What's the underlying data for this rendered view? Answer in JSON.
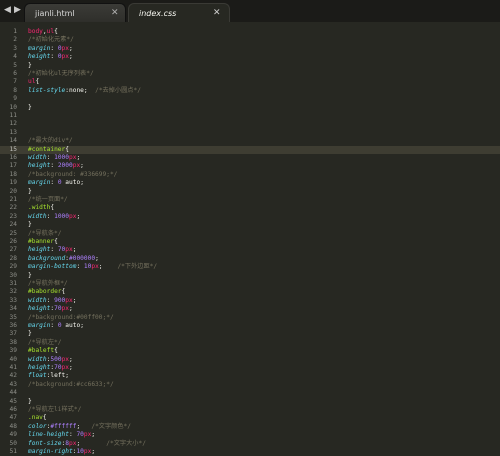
{
  "tabs": [
    {
      "label": "jianli.html",
      "active": false
    },
    {
      "label": "index.css",
      "active": true
    }
  ],
  "nav": {
    "back_icon": "arrow-left",
    "forward_icon": "arrow-right"
  },
  "editor": {
    "active_line": 15,
    "theme_colors": {
      "background": "#272822",
      "selector": "#f92672",
      "property": "#66d9ef",
      "number": "#ae81ff",
      "comment": "#75715e",
      "class_selector": "#a6e22e"
    },
    "lines": [
      [
        [
          "t-sel",
          "body"
        ],
        [
          "t-pun",
          ","
        ],
        [
          "t-sel",
          "ul"
        ],
        [
          "t-pun",
          "{"
        ]
      ],
      [
        [
          "t-cmt",
          "/*初始化元素*/"
        ]
      ],
      [
        [
          "t-prop",
          "margin"
        ],
        [
          "t-pun",
          ": "
        ],
        [
          "t-num",
          "0"
        ],
        [
          "t-unit",
          "px"
        ],
        [
          "t-pun",
          ";"
        ]
      ],
      [
        [
          "t-prop",
          "height"
        ],
        [
          "t-pun",
          ": "
        ],
        [
          "t-num",
          "0"
        ],
        [
          "t-unit",
          "px"
        ],
        [
          "t-pun",
          ";"
        ]
      ],
      [
        [
          "t-pun",
          "}"
        ]
      ],
      [
        [
          "t-cmt",
          "/*初始化ul无序列表*/"
        ]
      ],
      [
        [
          "t-sel",
          "ul"
        ],
        [
          "t-pun",
          "{"
        ]
      ],
      [
        [
          "t-prop",
          "list-style"
        ],
        [
          "t-pun",
          ":"
        ],
        [
          "t-val",
          "none"
        ],
        [
          "t-pun",
          ";  "
        ],
        [
          "t-cmt",
          "/*去掉小圆点*/"
        ]
      ],
      [],
      [
        [
          "t-pun",
          "}"
        ]
      ],
      [],
      [],
      [],
      [
        [
          "t-cmt",
          "/*最大的div*/"
        ]
      ],
      [
        [
          "t-cls",
          "#container"
        ],
        [
          "t-pun",
          "{"
        ]
      ],
      [
        [
          "t-prop",
          "width"
        ],
        [
          "t-pun",
          ": "
        ],
        [
          "t-num",
          "1000"
        ],
        [
          "t-unit",
          "px"
        ],
        [
          "t-pun",
          ";"
        ]
      ],
      [
        [
          "t-prop",
          "height"
        ],
        [
          "t-pun",
          ": "
        ],
        [
          "t-num",
          "2000"
        ],
        [
          "t-unit",
          "px"
        ],
        [
          "t-pun",
          ";"
        ]
      ],
      [
        [
          "t-cmt",
          "/*background: #336699;*/"
        ]
      ],
      [
        [
          "t-prop",
          "margin"
        ],
        [
          "t-pun",
          ": "
        ],
        [
          "t-num",
          "0"
        ],
        [
          "t-val",
          " auto"
        ],
        [
          "t-pun",
          ";"
        ]
      ],
      [
        [
          "t-pun",
          "}"
        ]
      ],
      [
        [
          "t-cmt",
          "/*统一页面*/"
        ]
      ],
      [
        [
          "t-cls",
          ".width"
        ],
        [
          "t-pun",
          "{"
        ]
      ],
      [
        [
          "t-prop",
          "width"
        ],
        [
          "t-pun",
          ": "
        ],
        [
          "t-num",
          "1000"
        ],
        [
          "t-unit",
          "px"
        ],
        [
          "t-pun",
          ";"
        ]
      ],
      [
        [
          "t-pun",
          "}"
        ]
      ],
      [
        [
          "t-cmt",
          "/*导航条*/"
        ]
      ],
      [
        [
          "t-cls",
          "#banner"
        ],
        [
          "t-pun",
          "{"
        ]
      ],
      [
        [
          "t-prop",
          "height"
        ],
        [
          "t-pun",
          ": "
        ],
        [
          "t-num",
          "70"
        ],
        [
          "t-unit",
          "px"
        ],
        [
          "t-pun",
          ";"
        ]
      ],
      [
        [
          "t-prop",
          "background"
        ],
        [
          "t-pun",
          ":"
        ],
        [
          "t-num",
          "#000000"
        ],
        [
          "t-pun",
          ";"
        ]
      ],
      [
        [
          "t-prop",
          "margin-bottom"
        ],
        [
          "t-pun",
          ": "
        ],
        [
          "t-num",
          "10"
        ],
        [
          "t-unit",
          "px"
        ],
        [
          "t-pun",
          ";    "
        ],
        [
          "t-cmt",
          "/*下外边距*/"
        ]
      ],
      [
        [
          "t-pun",
          "}"
        ]
      ],
      [
        [
          "t-cmt",
          "/*导航外框*/"
        ]
      ],
      [
        [
          "t-cls",
          "#baborder"
        ],
        [
          "t-pun",
          "{"
        ]
      ],
      [
        [
          "t-prop",
          "width"
        ],
        [
          "t-pun",
          ": "
        ],
        [
          "t-num",
          "900"
        ],
        [
          "t-unit",
          "px"
        ],
        [
          "t-pun",
          ";"
        ]
      ],
      [
        [
          "t-prop",
          "height"
        ],
        [
          "t-pun",
          ":"
        ],
        [
          "t-num",
          "70"
        ],
        [
          "t-unit",
          "px"
        ],
        [
          "t-pun",
          ";"
        ]
      ],
      [
        [
          "t-cmt",
          "/*background:#00ff00;*/"
        ]
      ],
      [
        [
          "t-prop",
          "margin"
        ],
        [
          "t-pun",
          ": "
        ],
        [
          "t-num",
          "0"
        ],
        [
          "t-val",
          " auto"
        ],
        [
          "t-pun",
          ";"
        ]
      ],
      [
        [
          "t-pun",
          "}"
        ]
      ],
      [
        [
          "t-cmt",
          "/*导航左*/"
        ]
      ],
      [
        [
          "t-cls",
          "#baleft"
        ],
        [
          "t-pun",
          "{"
        ]
      ],
      [
        [
          "t-prop",
          "width"
        ],
        [
          "t-pun",
          ":"
        ],
        [
          "t-num",
          "500"
        ],
        [
          "t-unit",
          "px"
        ],
        [
          "t-pun",
          ";"
        ]
      ],
      [
        [
          "t-prop",
          "height"
        ],
        [
          "t-pun",
          ":"
        ],
        [
          "t-num",
          "70"
        ],
        [
          "t-unit",
          "px"
        ],
        [
          "t-pun",
          ";"
        ]
      ],
      [
        [
          "t-prop",
          "float"
        ],
        [
          "t-pun",
          ":"
        ],
        [
          "t-val",
          "left"
        ],
        [
          "t-pun",
          ";"
        ]
      ],
      [
        [
          "t-cmt",
          "/*background:#cc6633;*/"
        ]
      ],
      [],
      [
        [
          "t-pun",
          "}"
        ]
      ],
      [
        [
          "t-cmt",
          "/*导航左li样式*/"
        ]
      ],
      [
        [
          "t-cls",
          ".nav"
        ],
        [
          "t-pun",
          "{"
        ]
      ],
      [
        [
          "t-prop",
          "color"
        ],
        [
          "t-pun",
          ":"
        ],
        [
          "t-num",
          "#ffffff"
        ],
        [
          "t-pun",
          ";   "
        ],
        [
          "t-cmt",
          "/*文字颜色*/"
        ]
      ],
      [
        [
          "t-prop",
          "line-height"
        ],
        [
          "t-pun",
          ": "
        ],
        [
          "t-num",
          "70"
        ],
        [
          "t-unit",
          "px"
        ],
        [
          "t-pun",
          ";"
        ]
      ],
      [
        [
          "t-prop",
          "font-size"
        ],
        [
          "t-pun",
          ":"
        ],
        [
          "t-num",
          "8"
        ],
        [
          "t-unit",
          "px"
        ],
        [
          "t-pun",
          ";       "
        ],
        [
          "t-cmt",
          "/*文字大小*/"
        ]
      ],
      [
        [
          "t-prop",
          "margin-right"
        ],
        [
          "t-pun",
          ":"
        ],
        [
          "t-num",
          "10"
        ],
        [
          "t-unit",
          "px"
        ],
        [
          "t-pun",
          ";"
        ]
      ]
    ]
  }
}
